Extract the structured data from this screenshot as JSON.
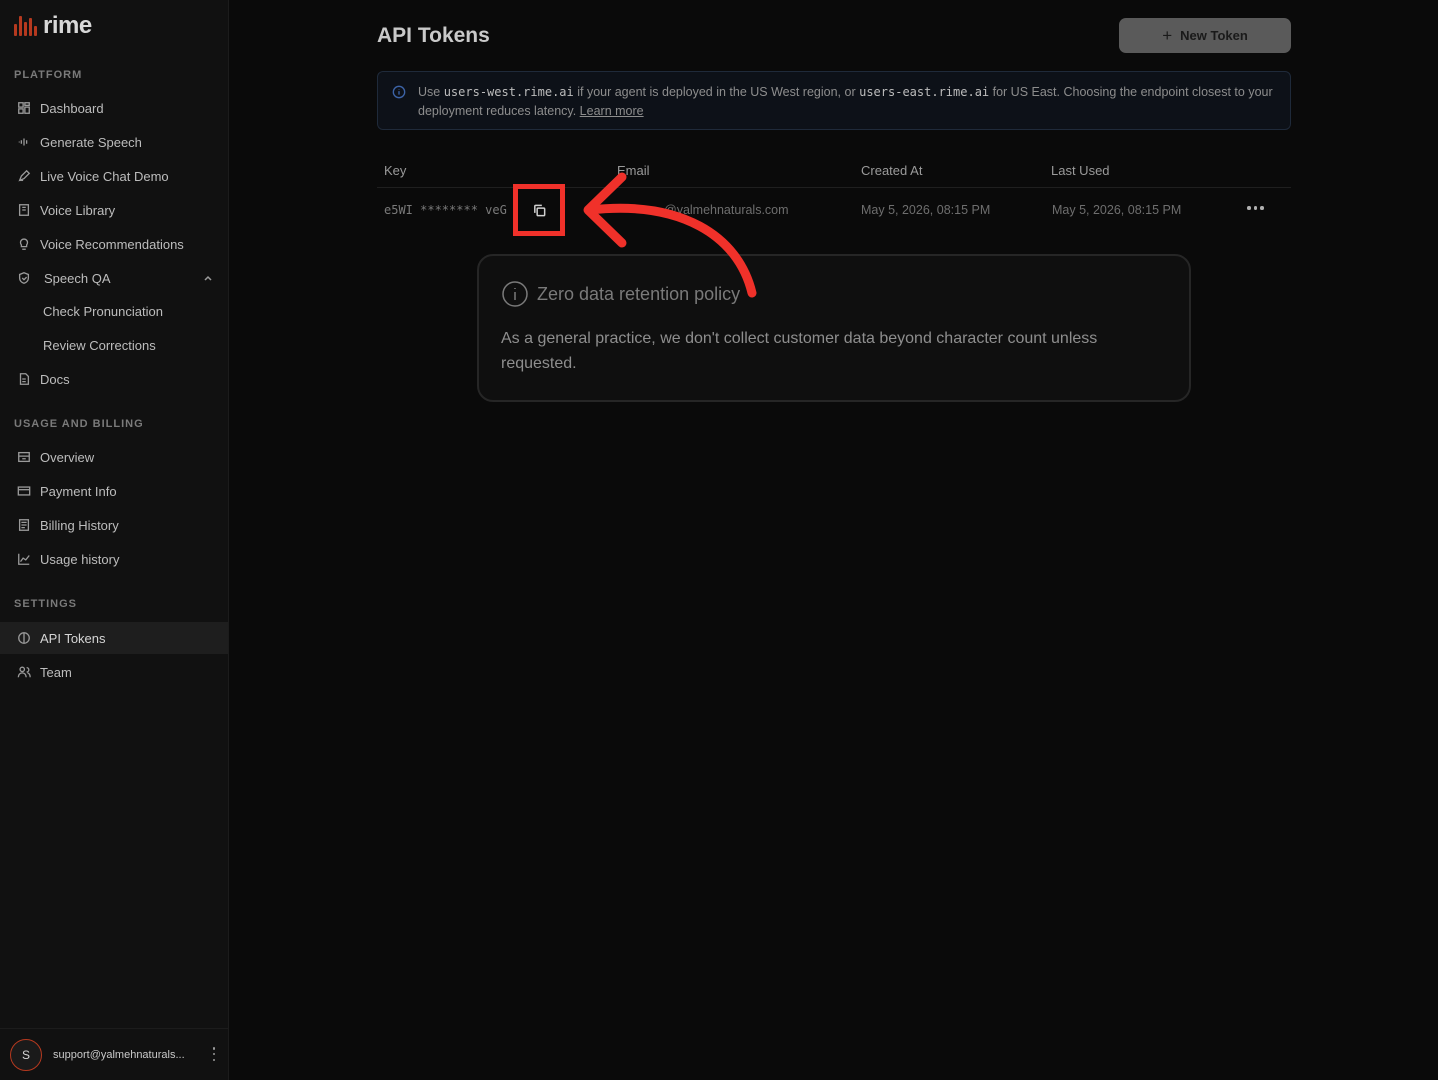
{
  "brand": {
    "name": "rime",
    "accent": "#b5391f",
    "highlight": "#f0312a"
  },
  "sidebar": {
    "sections": {
      "platform": "PLATFORM",
      "billing": "USAGE AND BILLING",
      "settings": "SETTINGS"
    },
    "platform_items": [
      {
        "label": "Dashboard",
        "icon": "grid-icon"
      },
      {
        "label": "Generate Speech",
        "icon": "waveform-icon"
      },
      {
        "label": "Live Voice Chat Demo",
        "icon": "pen-icon"
      },
      {
        "label": "Voice Library",
        "icon": "book-icon"
      },
      {
        "label": "Voice Recommendations",
        "icon": "lightbulb-icon"
      },
      {
        "label": "Speech QA",
        "icon": "shield-check-icon"
      },
      {
        "label": "Check Pronunciation"
      },
      {
        "label": "Review Corrections"
      },
      {
        "label": "Docs",
        "icon": "document-icon"
      }
    ],
    "billing_items": [
      {
        "label": "Overview",
        "icon": "archive-icon"
      },
      {
        "label": "Payment Info",
        "icon": "credit-card-icon"
      },
      {
        "label": "Billing History",
        "icon": "receipt-icon"
      },
      {
        "label": "Usage history",
        "icon": "chart-line-icon"
      }
    ],
    "settings_items": [
      {
        "label": "API Tokens",
        "icon": "token-icon",
        "active": true
      },
      {
        "label": "Team",
        "icon": "users-icon"
      }
    ],
    "user": {
      "initial": "S",
      "email": "support@yalmehnaturals..."
    }
  },
  "main": {
    "title": "API Tokens",
    "new_token_label": "New Token",
    "banner": {
      "text_1": "Use ",
      "west": "users-west.rime.ai",
      "text_2": " if your agent is deployed in the US West region, or ",
      "east": "users-east.rime.ai",
      "text_3": " for US East. Choosing the endpoint closest to your deployment reduces latency. ",
      "link": "Learn more"
    },
    "table": {
      "headers": [
        "Key",
        "Email",
        "Created At",
        "Last Used"
      ],
      "rows": [
        {
          "key": "e5WI ******** veG",
          "email": "@yalmehnaturals.com",
          "created": "May 5, 2026, 08:15 PM",
          "last_used": "May 5, 2026, 08:15 PM"
        }
      ]
    },
    "policy": {
      "title": "Zero data retention policy",
      "body": "As a general practice, we don't collect customer data beyond character count unless requested."
    }
  }
}
